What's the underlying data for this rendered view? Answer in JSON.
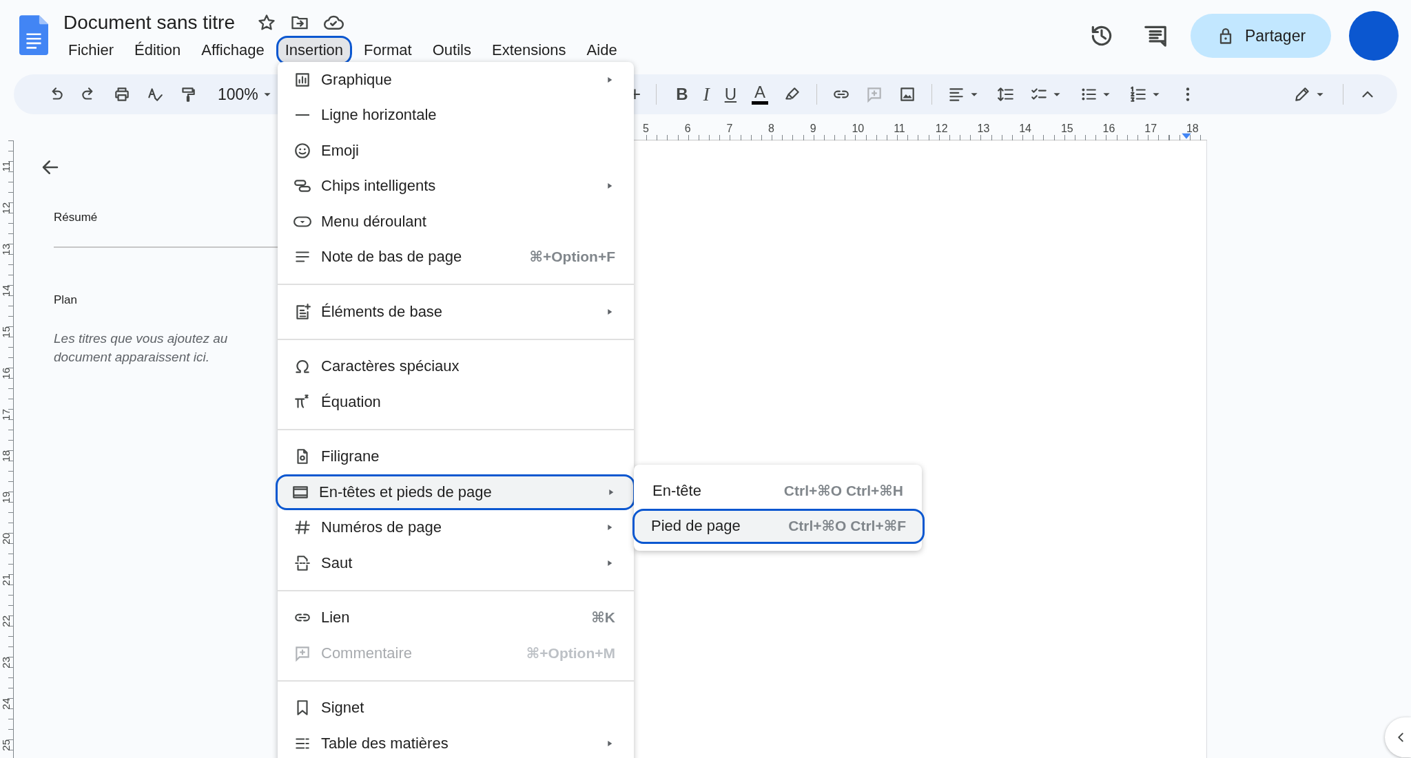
{
  "document": {
    "title": "Document sans titre"
  },
  "menubar": [
    {
      "label": "Fichier",
      "selected": false
    },
    {
      "label": "Édition",
      "selected": false
    },
    {
      "label": "Affichage",
      "selected": false
    },
    {
      "label": "Insertion",
      "selected": true
    },
    {
      "label": "Format",
      "selected": false
    },
    {
      "label": "Outils",
      "selected": false
    },
    {
      "label": "Extensions",
      "selected": false
    },
    {
      "label": "Aide",
      "selected": false
    }
  ],
  "share_button": {
    "label": "Partager"
  },
  "toolbar": {
    "zoom": "100%",
    "font_size_increase": "+",
    "bold": "B",
    "italic": "I",
    "underline": "U",
    "text_color": "A"
  },
  "ruler": {
    "horizontal": [
      "5",
      "6",
      "7",
      "8",
      "9",
      "10",
      "11",
      "12",
      "13",
      "14",
      "15",
      "16",
      "17",
      "18"
    ],
    "vertical": [
      "11",
      "12",
      "13",
      "14",
      "15",
      "16",
      "17",
      "18",
      "19",
      "20",
      "21",
      "22",
      "23",
      "24",
      "25"
    ]
  },
  "sidebar": {
    "summary_heading": "Résumé",
    "outline_heading": "Plan",
    "outline_hint": "Les titres que vous ajoutez au document apparaissent ici."
  },
  "insert_menu": [
    {
      "kind": "item",
      "label": "Graphique",
      "submenu": true,
      "disabled": false,
      "selected": false
    },
    {
      "kind": "item",
      "label": "Ligne horizontale",
      "submenu": false,
      "disabled": false,
      "selected": false
    },
    {
      "kind": "item",
      "label": "Emoji",
      "submenu": false,
      "disabled": false,
      "selected": false
    },
    {
      "kind": "item",
      "label": "Chips intelligents",
      "submenu": true,
      "disabled": false,
      "selected": false
    },
    {
      "kind": "item",
      "label": "Menu déroulant",
      "submenu": false,
      "disabled": false,
      "selected": false
    },
    {
      "kind": "item",
      "label": "Note de bas de page",
      "shortcut": "⌘+Option+F",
      "submenu": false,
      "disabled": false,
      "selected": false
    },
    {
      "kind": "separator"
    },
    {
      "kind": "item",
      "label": "Éléments de base",
      "submenu": true,
      "disabled": false,
      "selected": false
    },
    {
      "kind": "separator"
    },
    {
      "kind": "item",
      "label": "Caractères spéciaux",
      "submenu": false,
      "disabled": false,
      "selected": false
    },
    {
      "kind": "item",
      "label": "Équation",
      "submenu": false,
      "disabled": false,
      "selected": false
    },
    {
      "kind": "separator"
    },
    {
      "kind": "item",
      "label": "Filigrane",
      "submenu": false,
      "disabled": false,
      "selected": false
    },
    {
      "kind": "item",
      "label": "En-têtes et pieds de page",
      "submenu": true,
      "disabled": false,
      "selected": true
    },
    {
      "kind": "item",
      "label": "Numéros de page",
      "submenu": true,
      "disabled": false,
      "selected": false
    },
    {
      "kind": "item",
      "label": "Saut",
      "submenu": true,
      "disabled": false,
      "selected": false
    },
    {
      "kind": "separator"
    },
    {
      "kind": "item",
      "label": "Lien",
      "shortcut": "⌘K",
      "submenu": false,
      "disabled": false,
      "selected": false
    },
    {
      "kind": "item",
      "label": "Commentaire",
      "shortcut": "⌘+Option+M",
      "submenu": false,
      "disabled": true,
      "selected": false
    },
    {
      "kind": "separator"
    },
    {
      "kind": "item",
      "label": "Signet",
      "submenu": false,
      "disabled": false,
      "selected": false
    },
    {
      "kind": "item",
      "label": "Table des matières",
      "submenu": true,
      "disabled": false,
      "selected": false
    }
  ],
  "submenu": [
    {
      "label": "En-tête",
      "shortcut": "Ctrl+⌘O Ctrl+⌘H",
      "selected": false
    },
    {
      "label": "Pied de page",
      "shortcut": "Ctrl+⌘O Ctrl+⌘F",
      "selected": true
    }
  ]
}
